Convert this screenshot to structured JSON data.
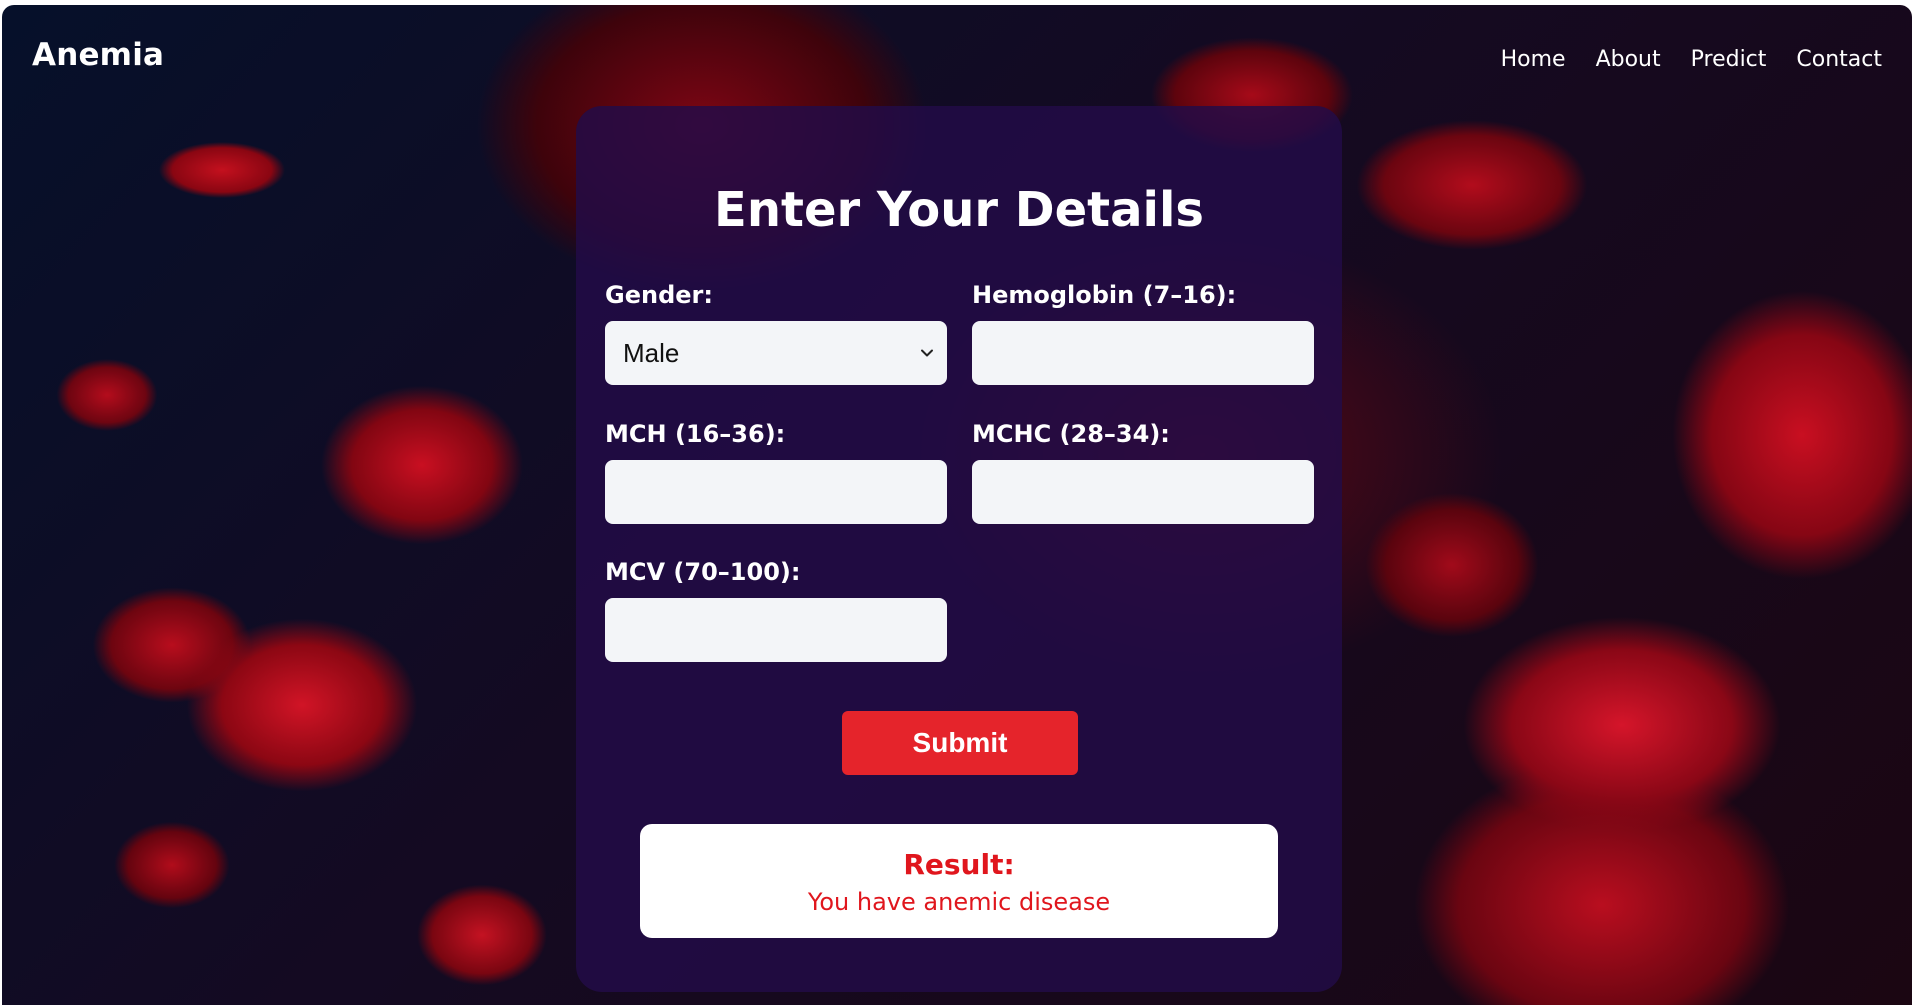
{
  "navbar": {
    "brand": "Anemia",
    "links": [
      {
        "label": "Home"
      },
      {
        "label": "About"
      },
      {
        "label": "Predict"
      },
      {
        "label": "Contact"
      }
    ]
  },
  "form": {
    "title": "Enter Your Details",
    "gender": {
      "label": "Gender:",
      "selected": "Male"
    },
    "hemoglobin": {
      "label": "Hemoglobin (7–16):",
      "value": ""
    },
    "mch": {
      "label": "MCH (16–36):",
      "value": ""
    },
    "mchc": {
      "label": "MCHC (28–34):",
      "value": ""
    },
    "mcv": {
      "label": "MCV (70–100):",
      "value": ""
    },
    "submit_label": "Submit"
  },
  "result": {
    "label": "Result:",
    "text": "You have anemic disease"
  },
  "colors": {
    "accent": "#e5242b",
    "result_text": "#e0161d",
    "card_bg": "#220c48"
  },
  "icons": {
    "select_arrow": "chevron-down-icon"
  }
}
